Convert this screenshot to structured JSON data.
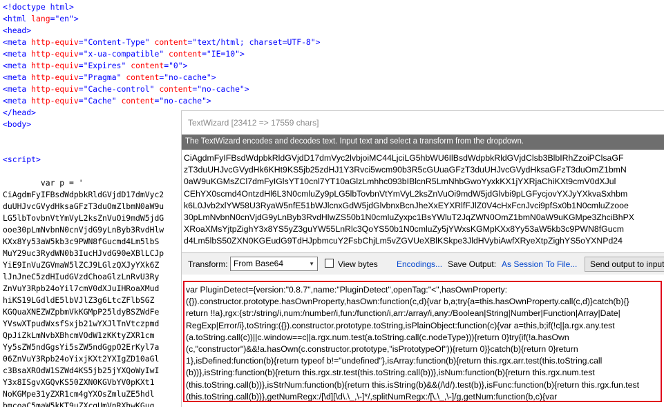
{
  "source": {
    "lines": [
      {
        "kind": "doctype",
        "text": "<!doctype html>"
      },
      {
        "kind": "tag",
        "open": "<html",
        "attr": "lang",
        "value": "\"en\"",
        "close": ">"
      },
      {
        "kind": "plain",
        "text": "<head>"
      },
      {
        "kind": "meta",
        "a1": "http-equiv",
        "v1": "\"Content-Type\"",
        "a2": "content",
        "v2": "\"text/html; charset=UTF-8\""
      },
      {
        "kind": "meta",
        "a1": "http-equiv",
        "v1": "\"x-ua-compatible\"",
        "a2": "content",
        "v2": "\"IE=10\""
      },
      {
        "kind": "meta",
        "a1": "http-equiv",
        "v1": "\"Expires\"",
        "a2": "content",
        "v2": "\"0\""
      },
      {
        "kind": "meta",
        "a1": "http-equiv",
        "v1": "\"Pragma\"",
        "a2": "content",
        "v2": "\"no-cache\""
      },
      {
        "kind": "meta",
        "a1": "http-equiv",
        "v1": "\"Cache-control\"",
        "a2": "content",
        "v2": "\"no-cache\""
      },
      {
        "kind": "meta",
        "a1": "http-equiv",
        "v1": "\"Cache\"",
        "a2": "content",
        "v2": "\"no-cache\""
      },
      {
        "kind": "plain",
        "text": "</head>"
      },
      {
        "kind": "plain",
        "text": "<body>"
      },
      {
        "kind": "blank",
        "text": ""
      },
      {
        "kind": "blank",
        "text": ""
      },
      {
        "kind": "plain",
        "text": "<script>"
      },
      {
        "kind": "blank",
        "text": ""
      },
      {
        "kind": "code",
        "text": "        var p = '"
      }
    ],
    "encoded_lines": [
      "CiAgdmFyIFBsdWdpbkRldGVjdD17dmVyc2",
      "duUHJvcGVydHksaGFzT3duOmZlbmN0aW9u",
      "LG5lbTovbnVtYmVyL2ksZnVuOi9mdW5jdG",
      "ooe30pLmNvbnN0cnVjdG9yLnByb3RvdHlw",
      "KXx8Yy53aW5kb3c9PWN8fGucmd4Lm5lbS",
      "MuY29uc3RydWN0b3IucHJvdG90eXBlLCJp",
      "YiE9InVuZGVmaW5lZCJ9LGlzQXJyYXk6Z",
      "lJnJneC5zdHIudGVzdChoaGlzLnRvU3Ry",
      "ZnVuY3Rpb24oYil7cmV0dXJuIHRoaXMud",
      "hiKS19LGdldE5lbVJlZ3g6LtcZFlbSGZ",
      "KGQuaXNEZWZpbmVkKGMpP25ldyBSZWdFe",
      "YVswXTpudWxsfSxjb21wYXJlTnVtczpmd",
      "QpJiZkLmNvbXBhcmVOdW1zKKtyZXR1cm",
      "Yy5sZW5ndGgsYi5sZW5ndGgpO2ErKyl7a",
      "06ZnVuY3Rpb24oYixjKXt2YXIgZD10aGl",
      "c3BsaXROdW1SZWd4KS5jb25jYXQoWyIwI",
      "Y3x8ISgvXGQvKS50ZXN0KGVbYV0pKXt1",
      "NoKGMpe31yZXR1cm4gYXOsZmluZE5hdl",
      "bmcoaC5maW5kKT9uZXcgUmVnRXhwKGug"
    ]
  },
  "wizard": {
    "title": "TextWizard [23412 => 17559 chars]",
    "banner": "The TextWizard encodes and decodes text. Input text and select a transform from the dropdown.",
    "input_lines": [
      "CiAgdmFyIFBsdWdpbkRldGVjdD17dmVyc2lvbjoiMC44LjciLG5hbWU6IlBsdWdpbkRldGVjdClsb3BlbIRhZzoiPClsaGF",
      "zT3duUHJvcGVydHk6KHt9KS5jb25zdHJ1Y3Rvci5wcm90b3R5cGUuaGFzT3duUHJvcGVydHksaGFzT3duOmZ1bmN",
      "0aW9uKGMsZCl7dmFyIGlsYT10cnl7YT10aGlzLmhhc093bIBlcnR5LmNhbGwoYyxkKX1jYXRjaChiKXt9cmV0dXJul",
      "CEhYX0scmd4OntzdHl6L3N0cmluZy9pLG5lbTovbnVtYmVyL2ksZnVuOi9mdW5jdGlvbi9pLGFycjovYXJyYXkvaSxhbm",
      "k6L0Jvb2xlYW58U3RyaW5nfE51bWJlcnxGdW5jdGlvbnxBcnJheXxEYXRlfFJlZ0V4cHxFcnJvci9pfSx0b1N0cmluZzooe",
      "30pLmNvbnN0cnVjdG9yLnByb3RvdHlwZS50b1N0cmluZyxpc1BsYWluT2JqZWN0OmZ1bmN0aW9uKGMpe3ZhciBhPX",
      "XRoaXMsYjtpZighY3x8YS5yZ3guYW55LnRlc3QoYS50b1N0cmluZy5jYWxsKGMpKXx8Yy53aW5kb3c9PWN8fGucm",
      "d4Lm5lbS50ZXN0KGEudG9TdHJpbmcuY2FsbChjLm5vZGVUeXBlKSkpe3JldHVybiAwfXRyeXtpZighYS5oYXNPd24"
    ],
    "toolbar": {
      "transform_label": "Transform:",
      "transform_value": "From Base64",
      "view_bytes_label": "View bytes",
      "encodings_link": "Encodings...",
      "save_label": "Save Output:",
      "as_session_link": "As Session",
      "to_file_link": "To File...",
      "send_button": "Send output to input"
    },
    "output_lines": [
      " var PluginDetect={version:\"0.8.7\",name:\"PluginDetect\",openTag:\"<\",hasOwnProperty:",
      "({}).constructor.prototype.hasOwnProperty,hasOwn:function(c,d){var b,a;try{a=this.hasOwnProperty.call(c,d)}catch(b){}",
      "return !!a},rgx:{str:/string/i,num:/number/i,fun:/function/i,arr:/array/i,any:/Boolean|String|Number|Function|Array|Date|",
      "RegExp|Error/i},toString:({}).constructor.prototype.toString,isPlainObject:function(c){var a=this,b;if(!c||a.rgx.any.test",
      "(a.toString.call(c))||c.window==c||a.rgx.num.test(a.toString.call(c.nodeType))){return 0}try{if(!a.hasOwn",
      "(c,\"constructor\")&&!a.hasOwn(c.constructor.prototype,\"isPrototypeOf\")){return 0}}catch(b){return 0}return",
      "1},isDefined:function(b){return typeof b!=\"undefined\"},isArray:function(b){return this.rgx.arr.test(this.toString.call",
      "(b))},isString:function(b){return this.rgx.str.test(this.toString.call(b))},isNum:function(b){return this.rgx.num.test",
      "(this.toString.call(b))},isStrNum:function(b){return this.isString(b)&&(/\\d/).test(b)},isFunc:function(b){return this.rgx.fun.test",
      "(this.toString.call(b))},getNumRegx:/[\\d][\\d\\.\\_,\\-]*/,splitNumRegx:/[\\.\\_,\\-]/g,getNum:function(b,c){var"
    ]
  }
}
